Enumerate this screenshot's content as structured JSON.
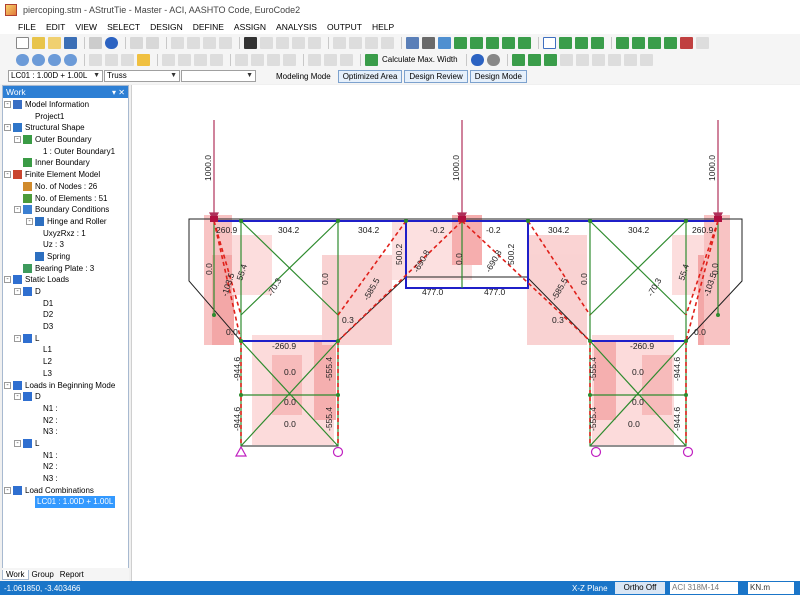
{
  "window": {
    "title": "piercoping.stm - AStrutTie - Master - ACI, AASHTO Code, EuroCode2"
  },
  "menu": [
    "FILE",
    "EDIT",
    "VIEW",
    "SELECT",
    "DESIGN",
    "DEFINE",
    "ASSIGN",
    "ANALYSIS",
    "OUTPUT",
    "HELP"
  ],
  "toolbar": {
    "calc_label": "Calculate Max. Width"
  },
  "selectors": {
    "load_case": "LC01 : 1.00D + 1.00L",
    "element_type": "Truss",
    "third": ""
  },
  "modes": [
    {
      "label": "Modeling Mode",
      "active": false
    },
    {
      "label": "Optimized Area",
      "active": true
    },
    {
      "label": "Design Review",
      "active": true
    },
    {
      "label": "Design Mode",
      "active": true
    }
  ],
  "panel": {
    "title": "Work",
    "tree": [
      {
        "label": "Model Information",
        "level": 0,
        "exp": "-",
        "icon": "model-info-icon",
        "color": "#3a6fc4"
      },
      {
        "label": "Project1",
        "level": 2,
        "exp": "",
        "icon": "",
        "color": ""
      },
      {
        "label": "Structural Shape",
        "level": 0,
        "exp": "-",
        "icon": "structural-shape-icon",
        "color": "#2f76c9"
      },
      {
        "label": "Outer Boundary",
        "level": 1,
        "exp": "-",
        "icon": "outer-boundary-icon",
        "color": "#3a9b45"
      },
      {
        "label": "1 : Outer Boundary1",
        "level": 3,
        "exp": "",
        "icon": "",
        "color": ""
      },
      {
        "label": "Inner Boundary",
        "level": 1,
        "exp": "",
        "icon": "inner-boundary-icon",
        "color": "#3a9b45"
      },
      {
        "label": "Finite Element Model",
        "level": 0,
        "exp": "-",
        "icon": "fem-icon",
        "color": "#c9452f"
      },
      {
        "label": "No. of Nodes : 26",
        "level": 1,
        "exp": "",
        "icon": "node-icon",
        "color": "#d08a2c"
      },
      {
        "label": "No. of Elements : 51",
        "level": 1,
        "exp": "",
        "icon": "element-icon",
        "color": "#4c9b3a"
      },
      {
        "label": "Boundary Conditions",
        "level": 1,
        "exp": "-",
        "icon": "boundary-icon",
        "color": "#3b7fd1"
      },
      {
        "label": "Hinge and Roller",
        "level": 2,
        "exp": "-",
        "icon": "hinge-icon",
        "color": "#2d6fc0"
      },
      {
        "label": "UxyzRxz : 1",
        "level": 3,
        "exp": "",
        "icon": "",
        "color": ""
      },
      {
        "label": "Uz : 3",
        "level": 3,
        "exp": "",
        "icon": "",
        "color": ""
      },
      {
        "label": "Spring",
        "level": 2,
        "exp": "",
        "icon": "spring-icon",
        "color": "#2d6fc0"
      },
      {
        "label": "Bearing Plate : 3",
        "level": 1,
        "exp": "",
        "icon": "bearing-plate-icon",
        "color": "#3d9a5c"
      },
      {
        "label": "Static Loads",
        "level": 0,
        "exp": "-",
        "icon": "static-loads-icon",
        "color": "#2f6fd0"
      },
      {
        "label": "D",
        "level": 1,
        "exp": "-",
        "icon": "load-d-icon",
        "color": "#2f6fd0"
      },
      {
        "label": "D1",
        "level": 3,
        "exp": "",
        "icon": "",
        "color": ""
      },
      {
        "label": "D2",
        "level": 3,
        "exp": "",
        "icon": "",
        "color": ""
      },
      {
        "label": "D3",
        "level": 3,
        "exp": "",
        "icon": "",
        "color": ""
      },
      {
        "label": "L",
        "level": 1,
        "exp": "-",
        "icon": "load-l-icon",
        "color": "#2f6fd0"
      },
      {
        "label": "L1",
        "level": 3,
        "exp": "",
        "icon": "",
        "color": ""
      },
      {
        "label": "L2",
        "level": 3,
        "exp": "",
        "icon": "",
        "color": ""
      },
      {
        "label": "L3",
        "level": 3,
        "exp": "",
        "icon": "",
        "color": ""
      },
      {
        "label": "Loads in Beginning Mode",
        "level": 0,
        "exp": "-",
        "icon": "beginning-loads-icon",
        "color": "#2f6fd0"
      },
      {
        "label": "D",
        "level": 1,
        "exp": "-",
        "icon": "bload-d-icon",
        "color": "#2f6fd0"
      },
      {
        "label": "N1 :",
        "level": 3,
        "exp": "",
        "icon": "",
        "color": ""
      },
      {
        "label": "N2 :",
        "level": 3,
        "exp": "",
        "icon": "",
        "color": ""
      },
      {
        "label": "N3 :",
        "level": 3,
        "exp": "",
        "icon": "",
        "color": ""
      },
      {
        "label": "L",
        "level": 1,
        "exp": "-",
        "icon": "bload-l-icon",
        "color": "#2f6fd0"
      },
      {
        "label": "N1 :",
        "level": 3,
        "exp": "",
        "icon": "",
        "color": ""
      },
      {
        "label": "N2 :",
        "level": 3,
        "exp": "",
        "icon": "",
        "color": ""
      },
      {
        "label": "N3 :",
        "level": 3,
        "exp": "",
        "icon": "",
        "color": ""
      },
      {
        "label": "Load Combinations",
        "level": 0,
        "exp": "-",
        "icon": "load-comb-icon",
        "color": "#2f6fd0"
      },
      {
        "label": "LC01 : 1.00D + 1.00L",
        "level": 2,
        "exp": "",
        "icon": "",
        "color": "",
        "selected": true
      }
    ],
    "tabs": [
      {
        "label": "Work",
        "active": true
      },
      {
        "label": "Group",
        "active": false
      },
      {
        "label": "Report",
        "active": false
      }
    ]
  },
  "model": {
    "load_labels": [
      "1000.0",
      "1000.0",
      "1000.0"
    ],
    "force_labels": [
      "260.9",
      "304.2",
      "304.2",
      "-0.2",
      "-0.2",
      "304.2",
      "304.2",
      "260.9",
      "0.0",
      "-103.5",
      "55.4",
      "-70.3",
      "0.0",
      "-585.5",
      "500.2",
      "-690.8",
      "0.0",
      "-690.8",
      "500.2",
      "-585.5",
      "0.0",
      "-70.3",
      "55.4",
      "-103.5",
      "0.0",
      "477.0",
      "477.0",
      "0.3",
      "0.3",
      "0.0",
      "-260.9",
      "-260.9",
      "0.0",
      "-944.6",
      "-555.4",
      "0.0",
      "0.0",
      "-944.6",
      "-555.4",
      "-555.4",
      "0.0",
      "0.0",
      "-944.6",
      "-555.4",
      "0.0",
      "0.0",
      "-944.6"
    ],
    "colors": {
      "tie": "#1f1fc8",
      "strut_green": "#2e8b2e",
      "strut_red_dash": "#e0201a",
      "heat": "#f07070",
      "load_arrow": "#b0305a",
      "support": "#c020c0"
    }
  },
  "status": {
    "coords": "-1.061850, -3.403466",
    "plane": "X-Z Plane",
    "ortho": "Ortho Off",
    "code": "ACI 318M-14",
    "units": "KN.m"
  }
}
